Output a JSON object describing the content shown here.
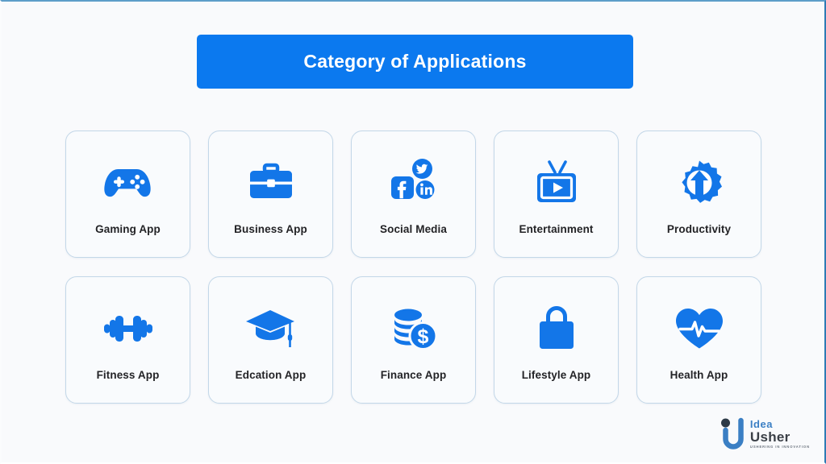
{
  "slide": {
    "background_color": "#f9fafc",
    "accent_color": "#0b79ef",
    "icon_color": "#1376e8",
    "label_color": "#232326"
  },
  "banner": {
    "title": "Category of Applications"
  },
  "cards": [
    {
      "label": "Gaming App",
      "icon": "game-controller-icon"
    },
    {
      "label": "Business App",
      "icon": "briefcase-icon"
    },
    {
      "label": "Social Media",
      "icon": "social-media-icon"
    },
    {
      "label": "Entertainment",
      "icon": "television-play-icon"
    },
    {
      "label": "Productivity",
      "icon": "gear-arrow-up-icon"
    },
    {
      "label": "Fitness App",
      "icon": "dumbbell-icon"
    },
    {
      "label": "Edcation App",
      "icon": "graduation-cap-icon"
    },
    {
      "label": "Finance App",
      "icon": "coins-dollar-icon"
    },
    {
      "label": "Lifestyle App",
      "icon": "shopping-bag-icon"
    },
    {
      "label": "Health App",
      "icon": "heart-pulse-icon"
    }
  ],
  "logo": {
    "name_top": "Idea",
    "name_bottom": "Usher",
    "tagline": "USHERING IN INNOVATION"
  }
}
